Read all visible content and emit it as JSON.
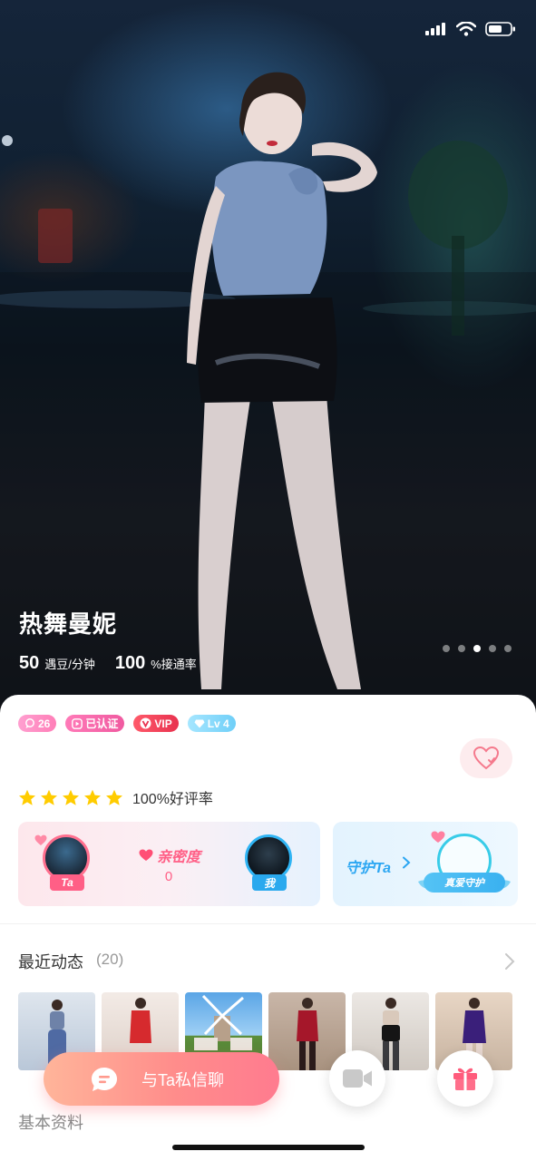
{
  "profile": {
    "name": "热舞曼妮",
    "price_value": "50",
    "price_unit": "遇豆/分钟",
    "connect_rate_value": "100",
    "connect_rate_unit": "%接通率",
    "photo_count": 5,
    "active_photo_index": 2
  },
  "badges": {
    "fans": "26",
    "verified": "已认证",
    "vip": "VIP",
    "level": "Lv 4"
  },
  "rating": {
    "stars": 5,
    "text": "100%好评率"
  },
  "intimacy": {
    "label": "亲密度",
    "value": "0",
    "ta_tag": "Ta",
    "me_tag": "我"
  },
  "guard": {
    "label": "守护Ta",
    "ribbon": "真爱守护"
  },
  "moments": {
    "title": "最近动态",
    "count": "(20)"
  },
  "basic_info_title": "基本资料",
  "actions": {
    "chat_label": "与Ta私信聊"
  },
  "colors": {
    "accent_pink": "#ff5f86",
    "accent_blue": "#2ba6f2",
    "star": "#ffcc00"
  }
}
